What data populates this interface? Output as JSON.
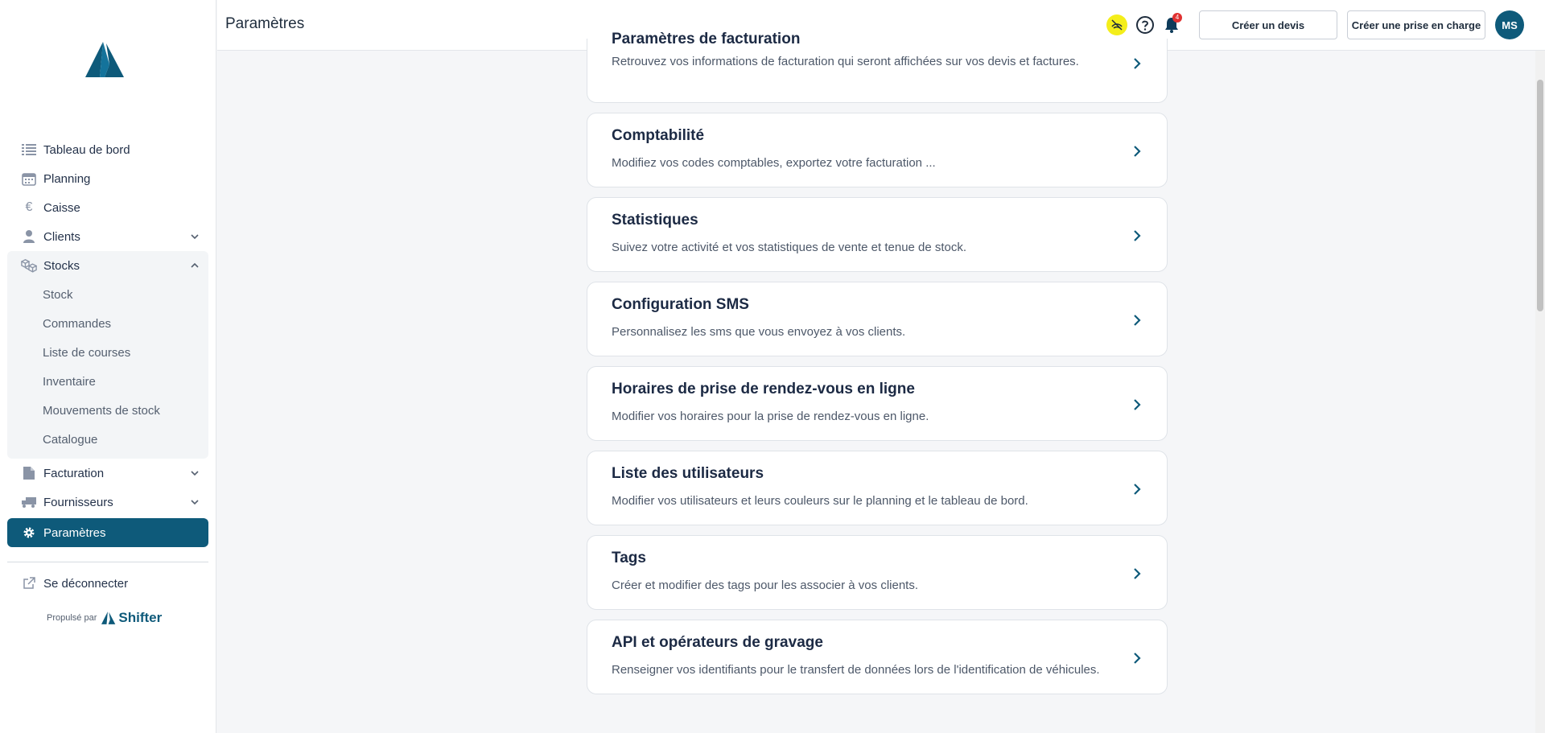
{
  "header": {
    "title": "Paramètres",
    "notification_count": "4",
    "create_quote_label": "Créer un devis",
    "create_intake_label": "Créer une prise en charge",
    "avatar_initials": "MS"
  },
  "sidebar": {
    "items": [
      {
        "label": "Tableau de bord",
        "icon": "list-icon"
      },
      {
        "label": "Planning",
        "icon": "calendar-icon"
      },
      {
        "label": "Caisse",
        "icon": "euro-icon"
      },
      {
        "label": "Clients",
        "icon": "user-icon"
      },
      {
        "label": "Stocks",
        "icon": "boxes-icon"
      },
      {
        "label": "Facturation",
        "icon": "document-icon"
      },
      {
        "label": "Fournisseurs",
        "icon": "truck-icon"
      },
      {
        "label": "Paramètres",
        "icon": "gear-icon"
      }
    ],
    "stocks_subitems": [
      "Stock",
      "Commandes",
      "Liste de courses",
      "Inventaire",
      "Mouvements de stock",
      "Catalogue"
    ],
    "logout_label": "Se déconnecter",
    "powered_by": "Propulsé par",
    "brand": "Shifter"
  },
  "cards": [
    {
      "title": "Paramètres de facturation",
      "desc": "Retrouvez vos informations de facturation qui seront affichées sur vos devis et factures."
    },
    {
      "title": "Comptabilité",
      "desc": "Modifiez vos codes comptables, exportez votre facturation ..."
    },
    {
      "title": "Statistiques",
      "desc": "Suivez votre activité et vos statistiques de vente et tenue de stock."
    },
    {
      "title": "Configuration SMS",
      "desc": "Personnalisez les sms que vous envoyez à vos clients."
    },
    {
      "title": "Horaires de prise de rendez-vous en ligne",
      "desc": "Modifier vos horaires pour la prise de rendez-vous en ligne."
    },
    {
      "title": "Liste des utilisateurs",
      "desc": "Modifier vos utilisateurs et leurs couleurs sur le planning et le tableau de bord."
    },
    {
      "title": "Tags",
      "desc": "Créer et modifier des tags pour les associer à vos clients."
    },
    {
      "title": "API et opérateurs de gravage",
      "desc": "Renseigner vos identifiants pour le transfert de données lors de l'identification de véhicules."
    }
  ],
  "colors": {
    "brand": "#0e5a7a",
    "badge": "#f4ee1a",
    "alert": "#e03131"
  }
}
